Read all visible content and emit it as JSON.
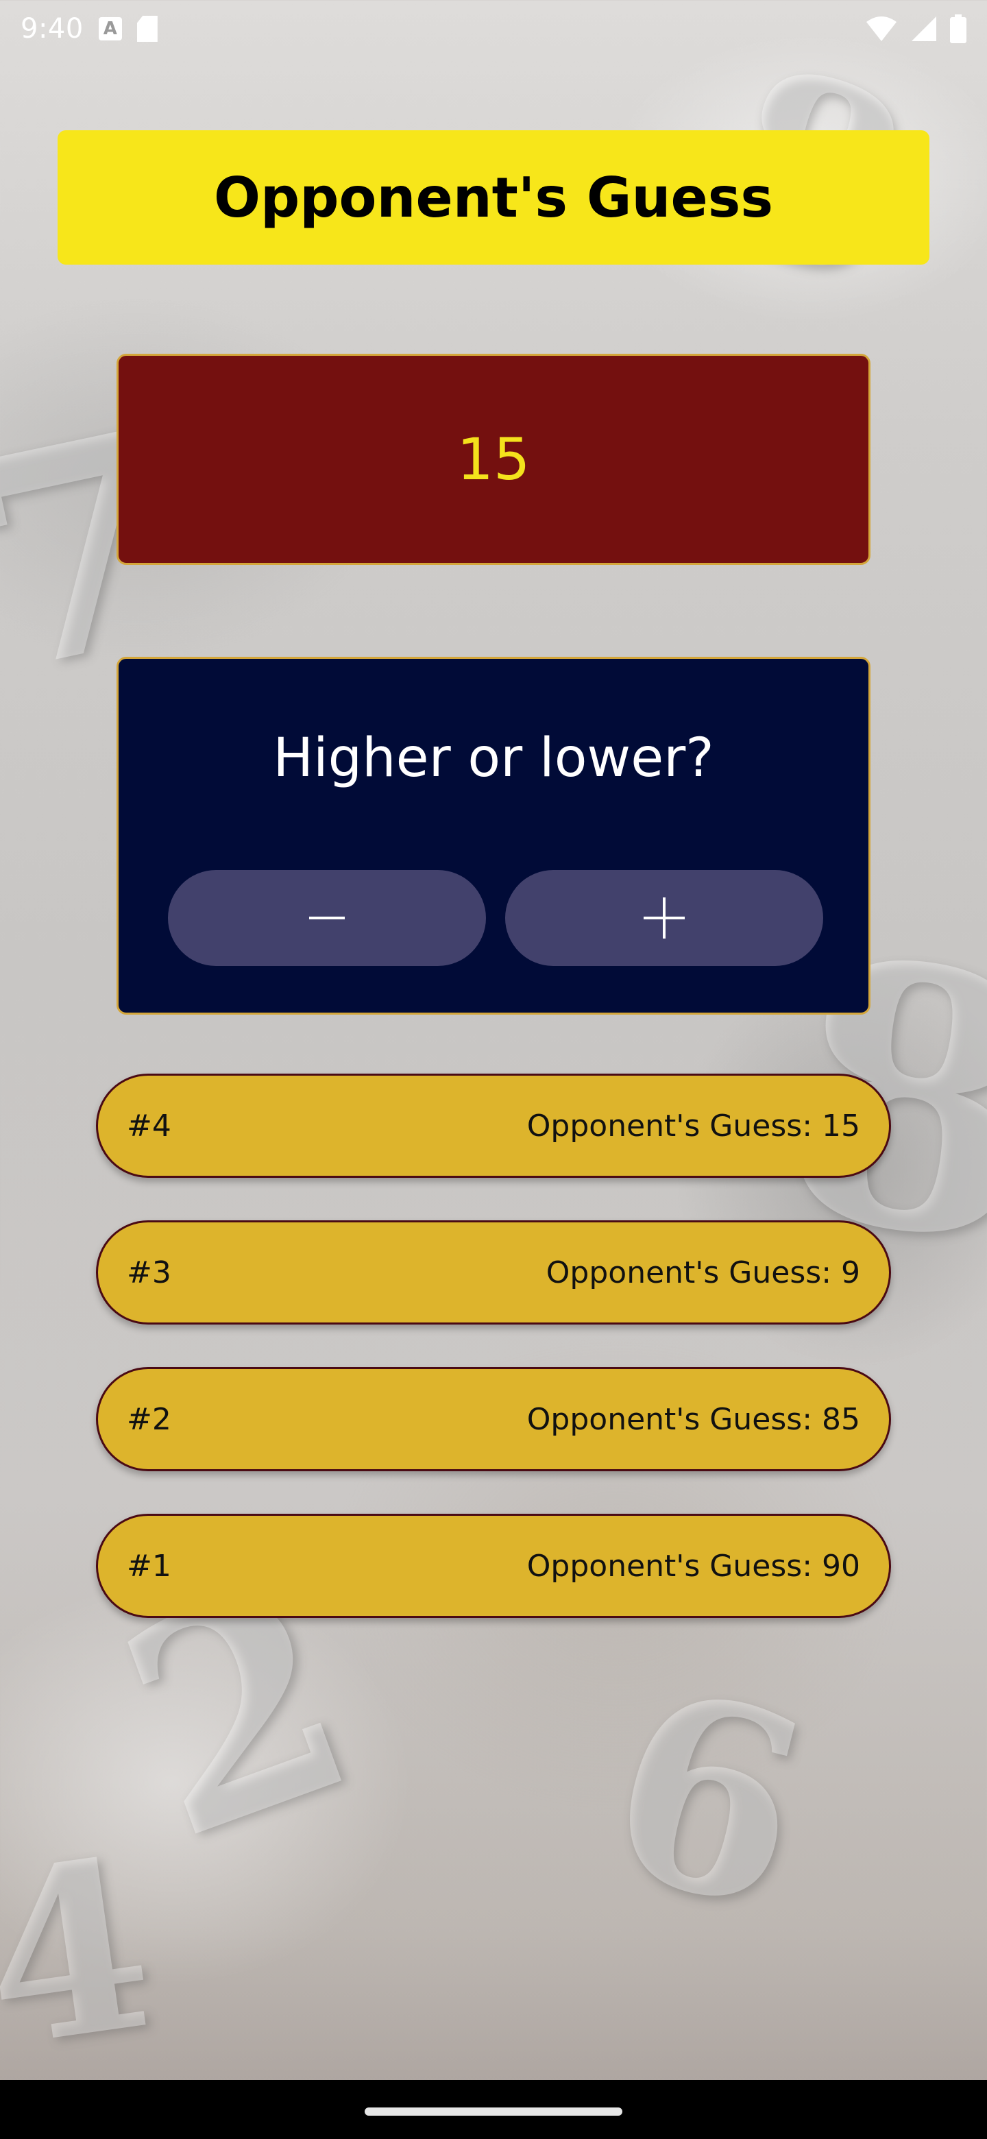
{
  "status_bar": {
    "time": "9:40",
    "icons": [
      "notification-a-icon",
      "sd-card-icon",
      "wifi-icon",
      "cell-signal-icon",
      "battery-icon"
    ]
  },
  "title": "Opponent's Guess",
  "current_guess": "15",
  "prompt": {
    "question": "Higher or lower?",
    "lower_icon": "minus-icon",
    "higher_icon": "plus-icon"
  },
  "guess_log": [
    {
      "round": "#4",
      "text": "Opponent's Guess: 15"
    },
    {
      "round": "#3",
      "text": "Opponent's Guess: 9"
    },
    {
      "round": "#2",
      "text": "Opponent's Guess: 85"
    },
    {
      "round": "#1",
      "text": "Opponent's Guess: 90"
    }
  ],
  "colors": {
    "title_banner": "#f7e61a",
    "guess_box": "#74100f",
    "guess_number": "#f4e21c",
    "card": "#010b37",
    "button": "#42416c",
    "log_item": "#ddb42c",
    "border_accent": "#d4a63a"
  }
}
